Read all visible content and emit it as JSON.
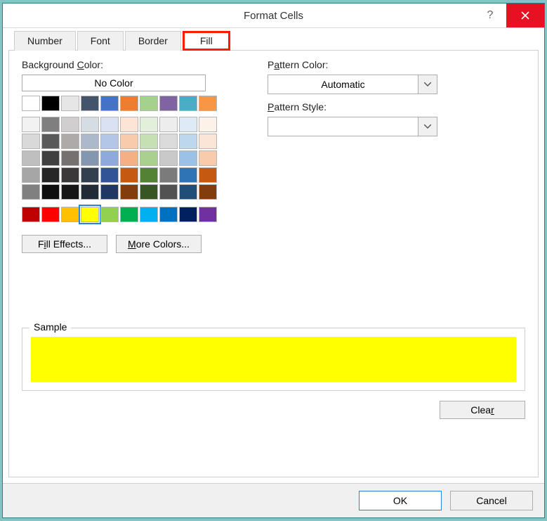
{
  "window": {
    "title": "Format Cells"
  },
  "tabs": {
    "number": "Number",
    "font": "Font",
    "border": "Border",
    "fill": "Fill",
    "active": "fill"
  },
  "labels": {
    "background_color": "Background Color:",
    "no_color": "No Color",
    "pattern_color": "Pattern Color:",
    "pattern_style": "Pattern Style:",
    "sample": "Sample"
  },
  "dropdowns": {
    "pattern_color_value": "Automatic",
    "pattern_style_value": ""
  },
  "buttons": {
    "fill_effects": "Fill Effects...",
    "more_colors": "More Colors...",
    "clear": "Clear",
    "ok": "OK",
    "cancel": "Cancel"
  },
  "theme_colors_row1": [
    "#ffffff",
    "#000000",
    "#e7e6e6",
    "#44546a",
    "#4472c4",
    "#ed7d31",
    "#a5d18e",
    "#8064a2",
    "#4bacc6",
    "#f79646"
  ],
  "theme_colors_shades": [
    [
      "#f2f2f2",
      "#7f7f7f",
      "#d0cece",
      "#d6dce4",
      "#d9e1f2",
      "#fce4d6",
      "#e2efda",
      "#ededed",
      "#deebf6",
      "#fdf2e9"
    ],
    [
      "#d9d9d9",
      "#595959",
      "#aeaaaa",
      "#acb9ca",
      "#b4c6e7",
      "#f8cbad",
      "#c6e0b4",
      "#dbdbdb",
      "#bdd7ee",
      "#fbe5d6"
    ],
    [
      "#bfbfbf",
      "#404040",
      "#757171",
      "#8497b0",
      "#8ea9db",
      "#f4b084",
      "#a9d08e",
      "#c9c9c9",
      "#9bc2e6",
      "#f8cbad"
    ],
    [
      "#a6a6a6",
      "#262626",
      "#3a3838",
      "#333f4f",
      "#305496",
      "#c65911",
      "#548235",
      "#7b7b7b",
      "#2f75b5",
      "#c65911"
    ],
    [
      "#808080",
      "#0d0d0d",
      "#161616",
      "#222b35",
      "#203764",
      "#833c0c",
      "#375623",
      "#525252",
      "#1f4e78",
      "#833c0c"
    ]
  ],
  "standard_colors": [
    "#c00000",
    "#ff0000",
    "#ffc000",
    "#ffff00",
    "#92d050",
    "#00b050",
    "#00b0f0",
    "#0070c0",
    "#002060",
    "#7030a0"
  ],
  "selected_color": "#ffff00",
  "sample_fill": "#ffff00"
}
